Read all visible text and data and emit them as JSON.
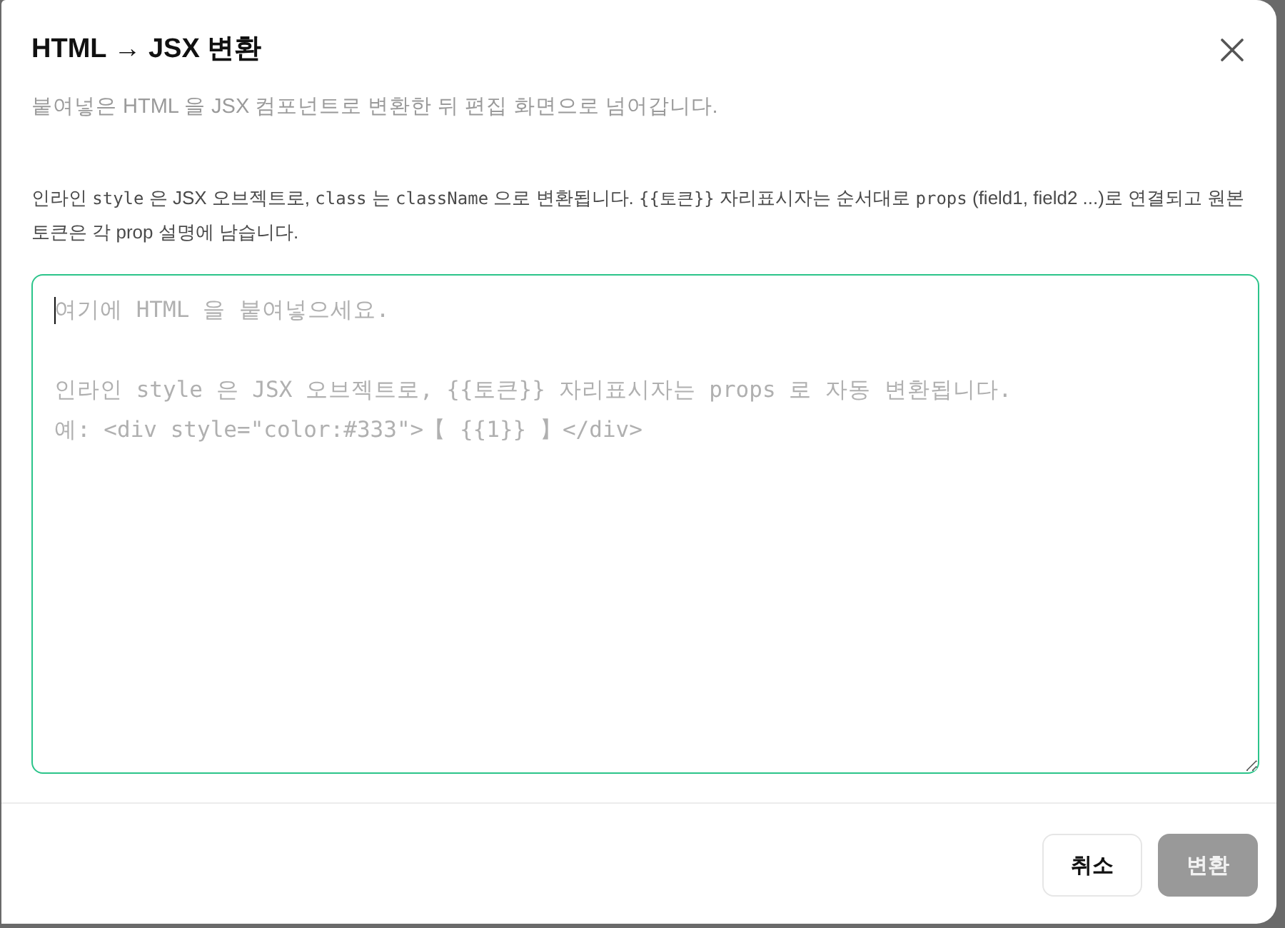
{
  "dialog": {
    "title": "HTML → JSX 변환",
    "subtitle": "붙여넣은 HTML 을 JSX 컴포넌트로 변환한 뒤 편집 화면으로 넘어갑니다."
  },
  "info": {
    "segments": [
      {
        "kind": "text",
        "text": "인라인 "
      },
      {
        "kind": "code",
        "text": "style"
      },
      {
        "kind": "text",
        "text": " 은 JSX 오브젝트로, "
      },
      {
        "kind": "code",
        "text": "class"
      },
      {
        "kind": "text",
        "text": " 는 "
      },
      {
        "kind": "code",
        "text": "className"
      },
      {
        "kind": "text",
        "text": " 으로 변환됩니다. "
      },
      {
        "kind": "code",
        "text": "{{토큰}}"
      },
      {
        "kind": "text",
        "text": " 자리표시자는 순서대로 "
      },
      {
        "kind": "code",
        "text": "props"
      },
      {
        "kind": "text",
        "text": " (field1, field2 ...)로 연결되고 원본 토큰은 각 prop 설명에 남습니다."
      }
    ]
  },
  "editor": {
    "placeholder": "여기에 HTML 을 붙여넣으세요.\n\n인라인 style 은 JSX 오브젝트로, {{토큰}} 자리표시자는 props 로 자동 변환됩니다.\n예: <div style=\"color:#333\">【 {{1}} 】</div>",
    "focused": true
  },
  "buttons": [
    {
      "label": "취소",
      "kind": "secondary",
      "disabled": false
    },
    {
      "label": "변환",
      "kind": "primary",
      "disabled": true
    }
  ]
}
